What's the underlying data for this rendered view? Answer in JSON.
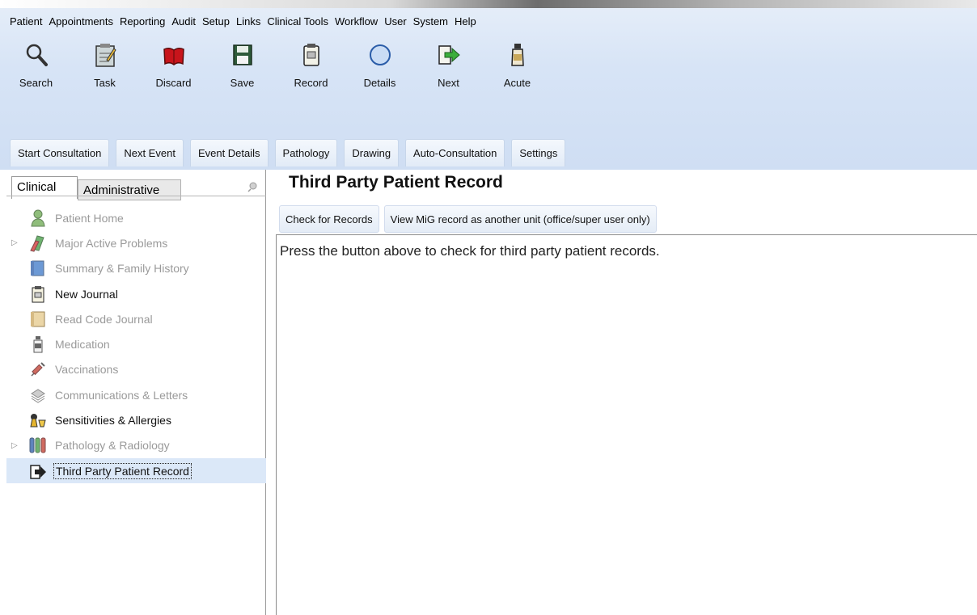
{
  "menu": [
    "Patient",
    "Appointments",
    "Reporting",
    "Audit",
    "Setup",
    "Links",
    "Clinical Tools",
    "Workflow",
    "User",
    "System",
    "Help"
  ],
  "toolbar": [
    {
      "label": "Search",
      "icon": "magnifier-icon"
    },
    {
      "label": "Task",
      "icon": "task-icon"
    },
    {
      "label": "Discard",
      "icon": "discard-book-icon"
    },
    {
      "label": "Save",
      "icon": "floppy-disk-icon"
    },
    {
      "label": "Record",
      "icon": "record-icon"
    },
    {
      "label": "Details",
      "icon": "circle-icon"
    },
    {
      "label": "Next",
      "icon": "next-arrow-icon"
    },
    {
      "label": "Acute",
      "icon": "bottle-icon"
    }
  ],
  "consultation_tabs": [
    "Start Consultation",
    "Next Event",
    "Event Details",
    "Pathology",
    "Drawing",
    "Auto-Consultation",
    "Settings"
  ],
  "left_tabs": {
    "clinical": "Clinical",
    "administrative": "Administrative"
  },
  "tree": [
    {
      "label": "Patient Home",
      "icon": "person-icon",
      "expandable": false,
      "enabled": false,
      "selected": false
    },
    {
      "label": "Major Active Problems",
      "icon": "problems-icon",
      "expandable": true,
      "enabled": false,
      "selected": false
    },
    {
      "label": "Summary & Family History",
      "icon": "summary-icon",
      "expandable": false,
      "enabled": false,
      "selected": false
    },
    {
      "label": "New Journal",
      "icon": "journal-icon",
      "expandable": false,
      "enabled": true,
      "selected": false
    },
    {
      "label": "Read Code Journal",
      "icon": "read-code-journal-icon",
      "expandable": false,
      "enabled": false,
      "selected": false
    },
    {
      "label": "Medication",
      "icon": "medication-bottle-icon",
      "expandable": false,
      "enabled": false,
      "selected": false
    },
    {
      "label": "Vaccinations",
      "icon": "syringe-icon",
      "expandable": false,
      "enabled": false,
      "selected": false
    },
    {
      "label": "Communications & Letters",
      "icon": "letters-icon",
      "expandable": false,
      "enabled": false,
      "selected": false
    },
    {
      "label": "Sensitivities & Allergies",
      "icon": "allergies-icon",
      "expandable": false,
      "enabled": true,
      "selected": false
    },
    {
      "label": "Pathology & Radiology",
      "icon": "test-tubes-icon",
      "expandable": true,
      "enabled": false,
      "selected": false
    },
    {
      "label": "Third Party Patient Record",
      "icon": "third-party-record-icon",
      "expandable": false,
      "enabled": true,
      "selected": true
    }
  ],
  "main": {
    "title": "Third Party Patient Record",
    "buttons": [
      "Check for Records",
      "View MiG record as another unit (office/super user only)"
    ],
    "message": "Press the button above to check for third party patient records."
  },
  "colors": {
    "ribbon": "#d7e4f6",
    "selection": "#dbe8f8",
    "disabled_text": "#9a9a9a"
  }
}
